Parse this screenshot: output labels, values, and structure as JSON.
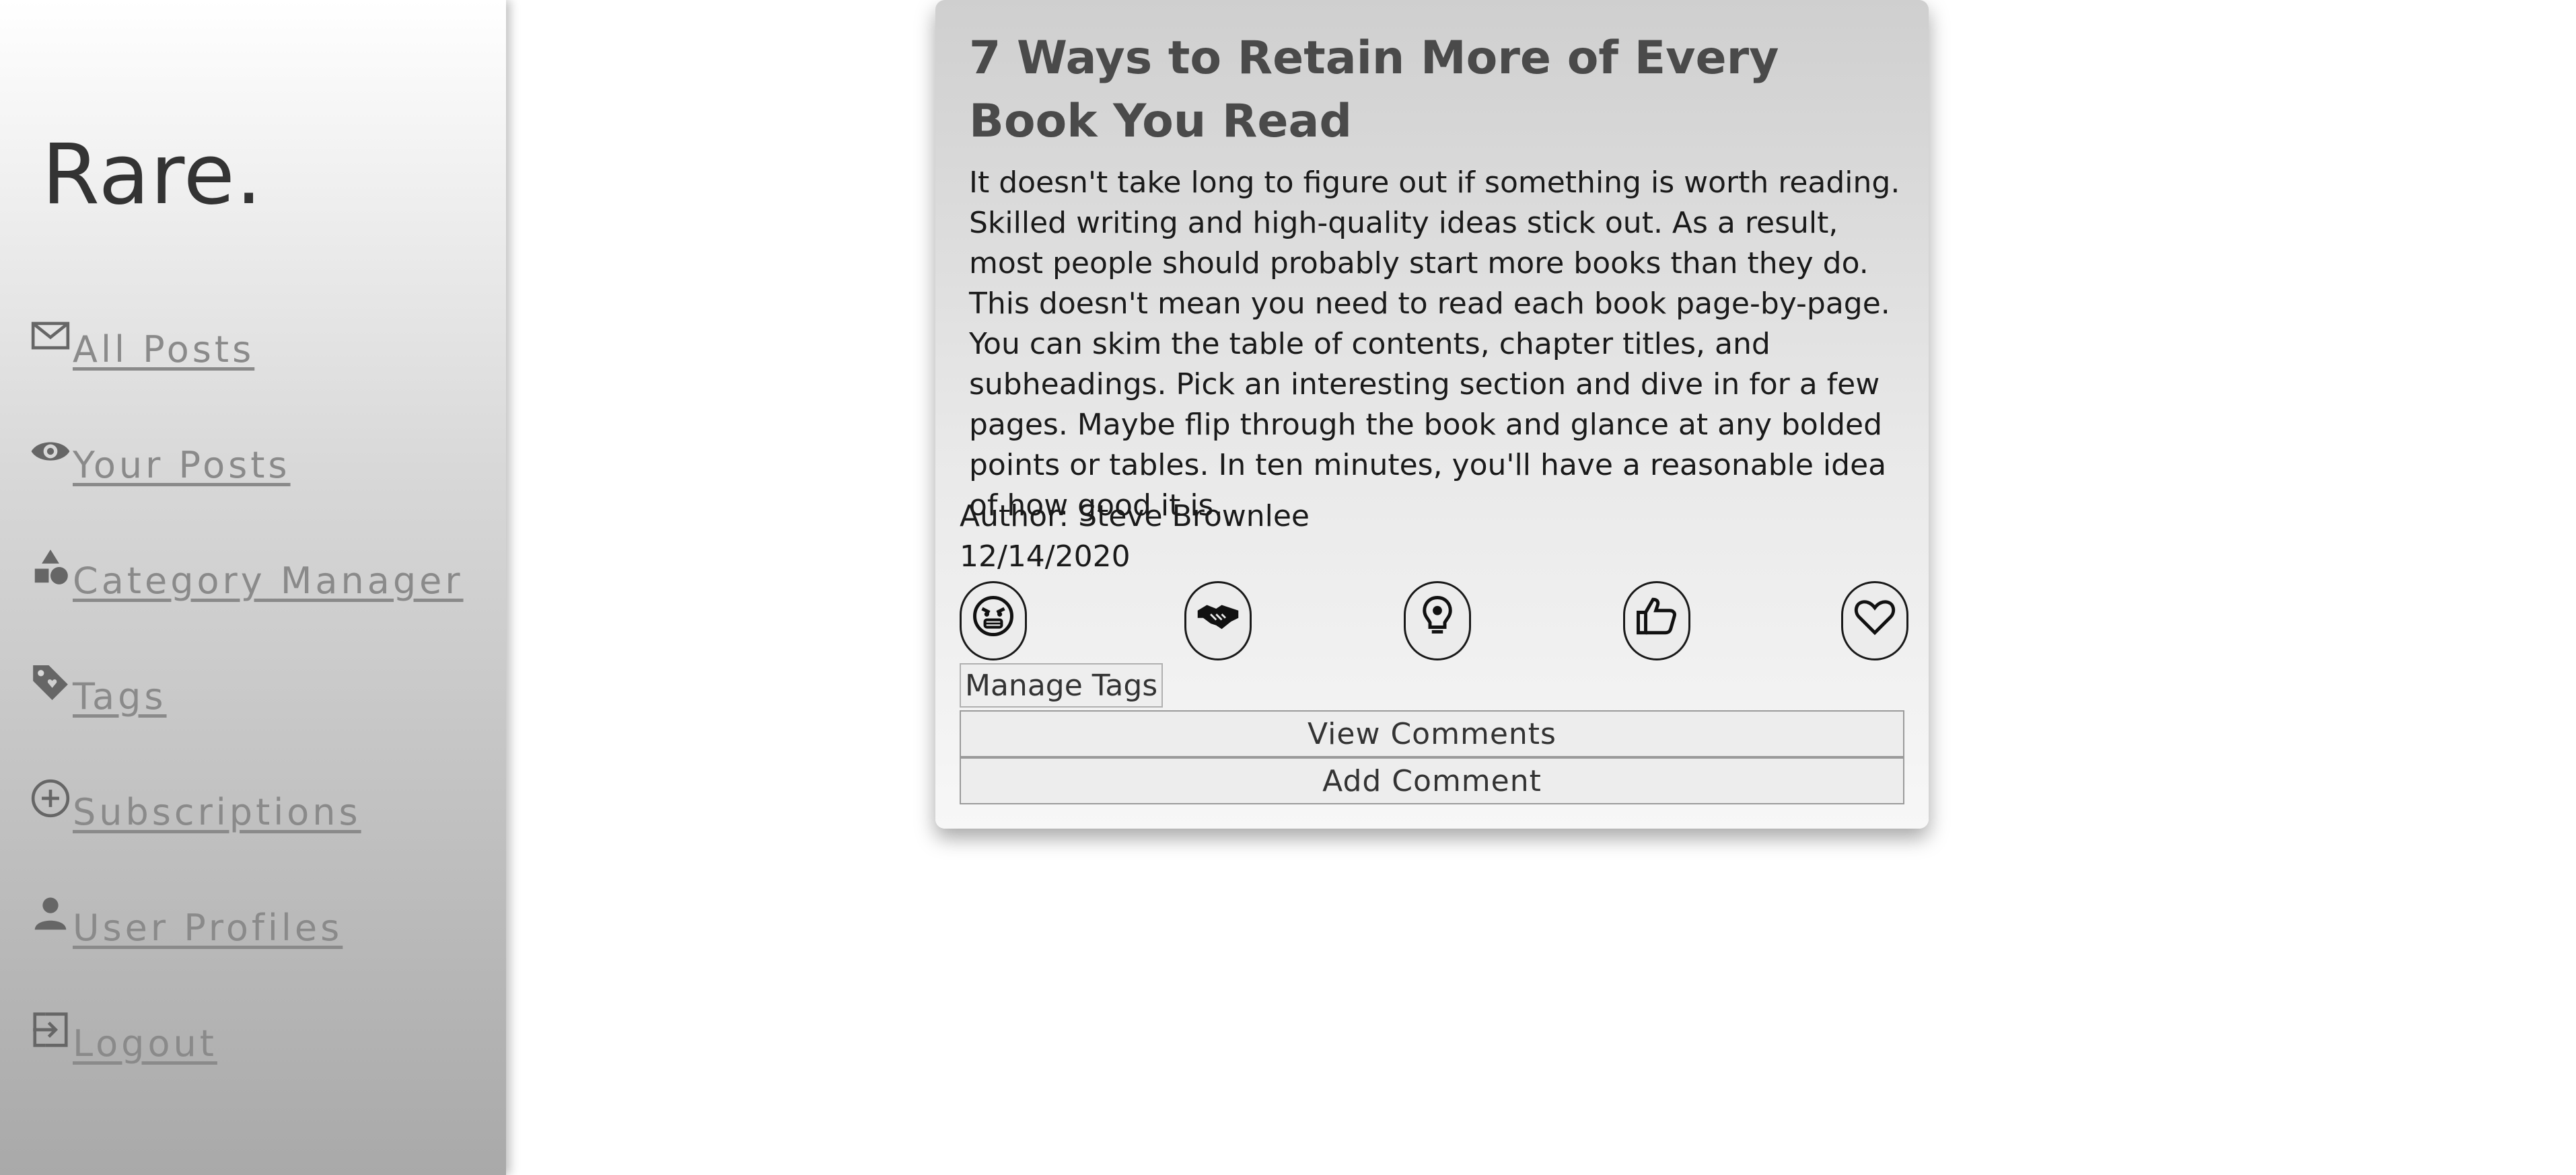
{
  "sidebar": {
    "brand": "Rare.",
    "items": [
      {
        "label": "All Posts",
        "icon": "envelope-icon"
      },
      {
        "label": "Your Posts",
        "icon": "eye-icon"
      },
      {
        "label": "Category Manager",
        "icon": "shapes-icon"
      },
      {
        "label": "Tags",
        "icon": "tag-icon"
      },
      {
        "label": "Subscriptions",
        "icon": "plus-circle-icon"
      },
      {
        "label": "User Profiles",
        "icon": "person-icon"
      },
      {
        "label": "Logout",
        "icon": "logout-icon"
      }
    ]
  },
  "post": {
    "title": "7 Ways to Retain More of Every Book You Read",
    "body": "It doesn't take long to figure out if something is worth reading. Skilled writing and high-quality ideas stick out. As a result, most people should probably start more books than they do. This doesn't mean you need to read each book page-by-page. You can skim the table of contents, chapter titles, and subheadings. Pick an interesting section and dive in for a few pages. Maybe flip through the book and glance at any bolded points or tables. In ten minutes, you'll have a reasonable idea of how good it is.",
    "author": "Author: Steve Brownlee",
    "date": "12/14/2020",
    "reactions": [
      "angry-face-icon",
      "handshake-icon",
      "lightbulb-icon",
      "thumbs-up-icon",
      "heart-icon"
    ],
    "manage_tags_label": "Manage Tags",
    "view_comments_label": "View Comments",
    "add_comment_label": "Add Comment"
  },
  "colors": {
    "nav_text": "#8a8a8a",
    "title_text": "#4a4a4a",
    "card_top": "#cfcfcf",
    "card_bottom": "#f7f7f7"
  }
}
